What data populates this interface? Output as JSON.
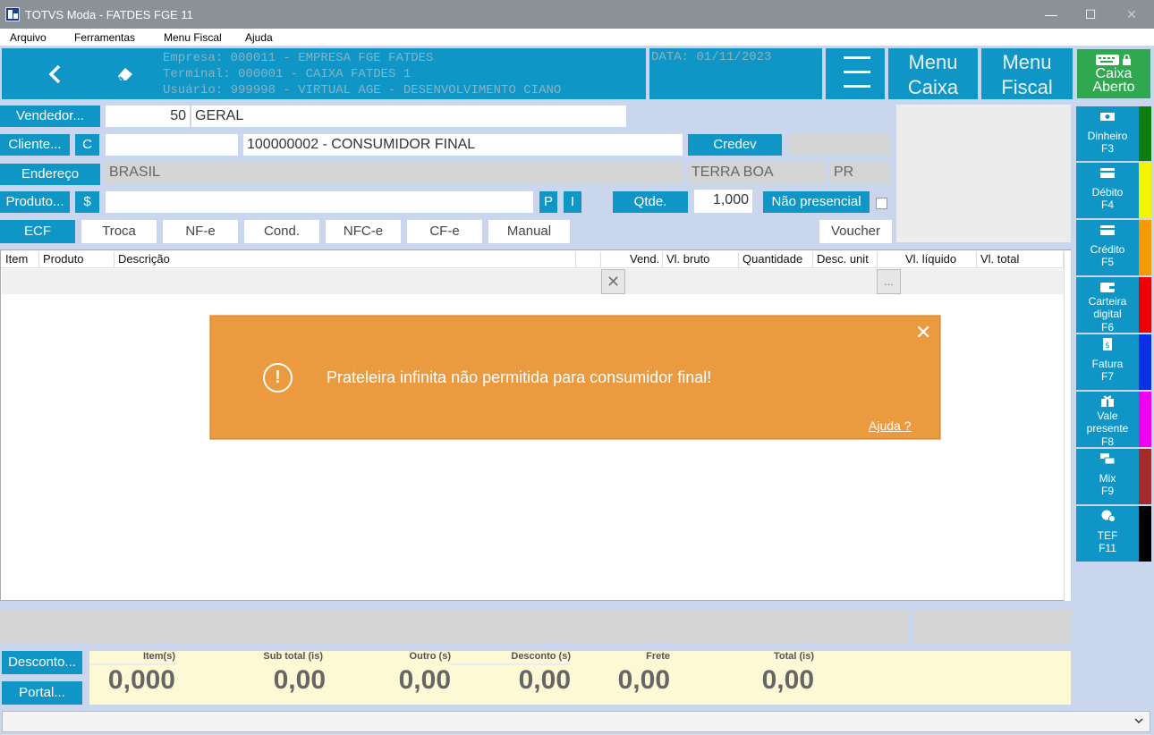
{
  "window": {
    "title": "TOTVS Moda - FATDES FGE 11",
    "minimize": "—",
    "maximize": "☐",
    "close": "✕"
  },
  "menu": [
    "Arquivo",
    "Ferramentas",
    "Menu Fiscal",
    "Ajuda"
  ],
  "header": {
    "empresa": "Empresa:  000011 - EMPRESA FGE FATDES",
    "terminal": "Terminal: 000001 - CAIXA FATDES 1",
    "usuario": "Usuário:  999998 - VIRTUAL AGE - DESENVOLVIMENTO CIANO",
    "data": "DATA: 01/11/2023",
    "menu_caixa": [
      "Menu",
      "Caixa"
    ],
    "menu_fiscal": [
      "Menu",
      "Fiscal"
    ],
    "caixa_aberto": [
      "Caixa",
      "Aberto"
    ]
  },
  "form": {
    "vendedor_btn": "Vendedor...",
    "vendedor_code": "50",
    "vendedor_name": "GERAL",
    "cliente_btn": "Cliente...",
    "cliente_c": "C",
    "cliente_name": "100000002 - CONSUMIDOR FINAL",
    "credev_btn": "Credev",
    "endereco_btn": "Endereço",
    "pais": "BRASIL",
    "cidade": "TERRA BOA",
    "uf": "PR",
    "produto_btn": "Produto...",
    "produto_dollar": "$",
    "btn_p": "P",
    "btn_i": "I",
    "qtde_btn": "Qtde.",
    "qtde_value": "1,000",
    "nao_presencial": "Não presencial"
  },
  "doc_tabs": [
    "ECF",
    "Troca",
    "NF-e",
    "Cond.",
    "NFC-e",
    "CF-e",
    "Manual"
  ],
  "voucher_btn": "Voucher",
  "grid_columns": [
    "Item",
    "Produto",
    "Descrição",
    "Vend.",
    "Vl. bruto",
    "Quantidade",
    "Desc. unit",
    "Vl. líquido",
    "Vl. total"
  ],
  "toast": {
    "message": "Prateleira infinita não permitida para consumidor final!",
    "help": "Ajuda ?",
    "icon": "exclamation-circle-icon",
    "close": "✕"
  },
  "payments": [
    {
      "label": "Dinheiro",
      "key": "F3",
      "color": "#0d7d0d",
      "icon": "cash-icon"
    },
    {
      "label": "Débito",
      "key": "F4",
      "color": "#f5f500",
      "icon": "card-icon"
    },
    {
      "label": "Crédito",
      "key": "F5",
      "color": "#f59a00",
      "icon": "card-icon"
    },
    {
      "label": "Carteira digital",
      "key": "F6",
      "color": "#ee0000",
      "icon": "wallet-icon"
    },
    {
      "label": "Fatura",
      "key": "F7",
      "color": "#0a2fe6",
      "icon": "invoice-icon"
    },
    {
      "label": "Vale presente",
      "key": "F8",
      "color": "#f000f0",
      "icon": "gift-icon"
    },
    {
      "label": "Mix",
      "key": "F9",
      "color": "#a52a2a",
      "icon": "mix-icon"
    },
    {
      "label": "TEF",
      "key": "F11",
      "color": "#000000",
      "icon": "tef-icon"
    }
  ],
  "footer": {
    "desconto_btn": "Desconto...",
    "portal_btn": "Portal...",
    "totals": [
      {
        "label": "Item(s)",
        "value": "0,000"
      },
      {
        "label": "Sub total (is)",
        "value": "0,00"
      },
      {
        "label": "Outro (s)",
        "value": "0,00"
      },
      {
        "label": "Desconto (s)",
        "value": "0,00"
      },
      {
        "label": "Frete",
        "value": "0,00"
      },
      {
        "label": "Total (is)",
        "value": "0,00"
      }
    ]
  }
}
